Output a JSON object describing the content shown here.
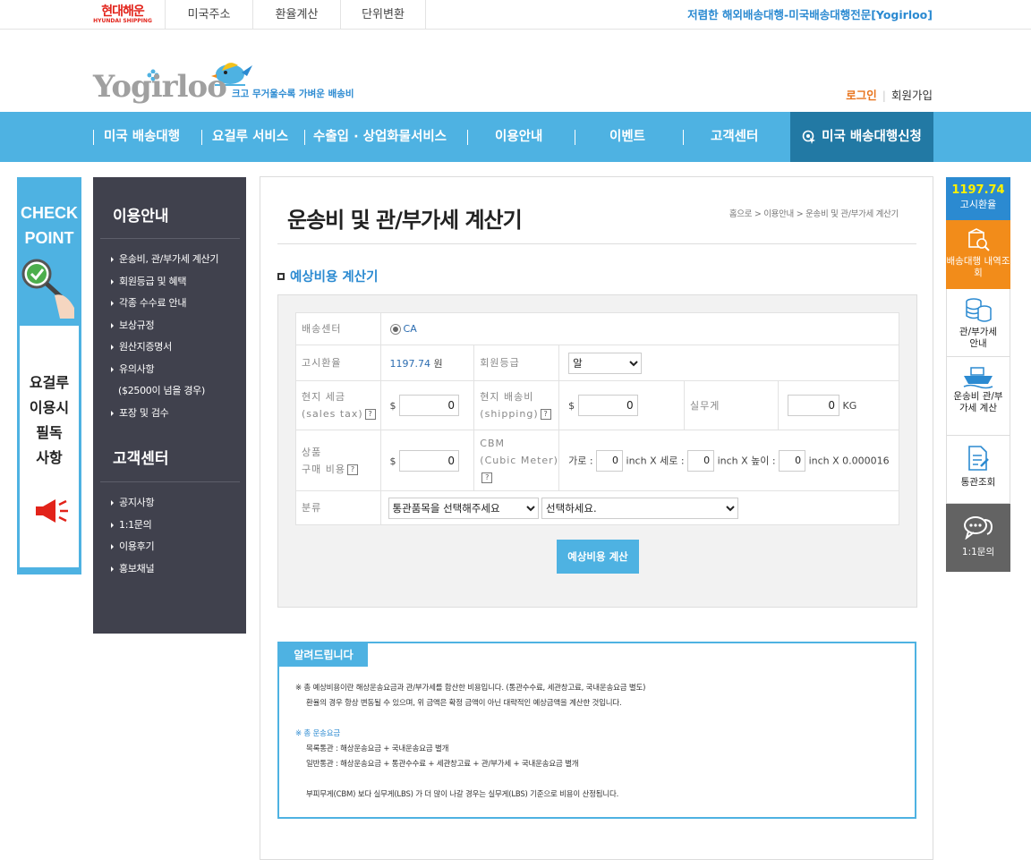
{
  "topbar": {
    "logo_main": "현대해운",
    "logo_sub": "HYUNDAI SHIPPING",
    "links": [
      "미국주소",
      "환율계산",
      "단위변환"
    ],
    "tagline": "저렴한 해외배송대행-미국배송대행전문[Yogirloo]"
  },
  "header": {
    "logo": "Yogirloo",
    "slogan": "크고 무거울수록 가벼운 배송비",
    "login": "로그인",
    "join": "회원가입"
  },
  "nav": {
    "items": [
      "미국 배송대행",
      "요걸루 서비스",
      "수출입 · 상업화물서비스",
      "이용안내",
      "이벤트",
      "고객센터"
    ],
    "apply": "미국 배송대행신청"
  },
  "checkpoint": {
    "title1": "CHECK",
    "title2": "POINT",
    "line1": "요걸루",
    "line2": "이용시",
    "line3": "필독",
    "line4": "사항"
  },
  "sidebar": {
    "guide_title": "이용안내",
    "guide_items": [
      "운송비, 관/부가세 계산기",
      "회원등급 및 혜택",
      "각종 수수료 안내",
      "보상규정",
      "원산지증명서",
      "유의사항"
    ],
    "guide_sub": "($2500이 넘을 경우)",
    "guide_last": "포장 및 검수",
    "cs_title": "고객센터",
    "cs_items": [
      "공지사항",
      "1:1문의",
      "이용후기",
      "홍보채널"
    ]
  },
  "content": {
    "title": "운송비 및 관/부가세 계산기",
    "breadcrumb": "홈으로 > 이용안내 > 운송비 및 관/부가세 계산기",
    "section": "예상비용 계산기",
    "calc": {
      "center_label": "배송센터",
      "center_value": "CA",
      "rate_label": "고시환율",
      "rate_value": "1197.74",
      "rate_unit": "원",
      "grade_label": "회원등급",
      "grade_value": "알",
      "sales_tax_label1": "현지 세금",
      "sales_tax_label2": "(sales tax)",
      "sales_tax_value": "0",
      "shipping_label1": "현지 배송비",
      "shipping_label2": "(shipping)",
      "shipping_value": "0",
      "weight_label": "실무게",
      "weight_value": "0",
      "weight_unit": "KG",
      "price_label1": "상품",
      "price_label2": "구매 비용",
      "price_value": "0",
      "cbm_label1": "CBM",
      "cbm_label2": "(Cubic Meter)",
      "cbm_width_label": "가로 :",
      "cbm_width": "0",
      "cbm_x1": "inch X 세로 :",
      "cbm_length": "0",
      "cbm_x2": "inch X 높이 :",
      "cbm_height": "0",
      "cbm_x3": "inch X 0.000016",
      "currency": "$",
      "q": "?",
      "category_label": "분류",
      "category1": "통관품목을 선택해주세요",
      "category2": "선택하세요.",
      "button": "예상비용 계산"
    },
    "notice": {
      "tag": "알려드립니다",
      "line1": "※ 총 예상비용이란 해상운송요금과 관/부가세를 합산한 비용입니다. (통관수수료, 세관창고료, 국내운송요금 별도)",
      "line2": "환율의 경우 항상 변동될 수 있으며, 위 금액은 확정 금액이 아닌 대략적인 예상금액을 계산한 것입니다.",
      "heading": "※ 총 운송요금",
      "line3": "목록통관 : 해상운송요금 + 국내운송요금 별개",
      "line4": "일반통관 : 해상운송요금 + 통관수수료 + 세관창고료 + 관/부가세 + 국내운송요금 별개",
      "line5": "부피무게(CBM) 보다 실무게(LBS) 가 더 많이 나갈 경우는 실무게(LBS) 기준으로 비용이 산정됩니다."
    }
  },
  "quick": {
    "rate_value": "1197.74",
    "rate_label": "고시환율",
    "history": "배송대행 내역조회",
    "tax_guide": "관/부가세 안내",
    "shipping_calc": "운송비 관/부가세 계산",
    "customs": "통관조회",
    "inquiry": "1:1문의"
  },
  "colors": {
    "brand_blue": "#4eb2e2",
    "dark_blue": "#2279a4",
    "orange": "#f28c1a",
    "sidebar_dark": "#40414d"
  }
}
